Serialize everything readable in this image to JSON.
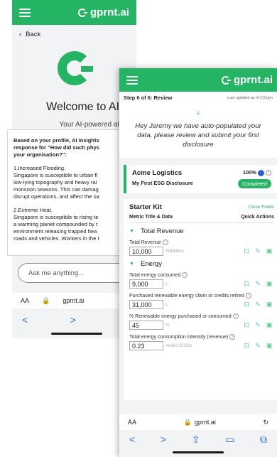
{
  "left": {
    "brand": "gprnt.ai",
    "back_label": "Back",
    "welcome_title": "Welcome to AI In",
    "tagline": "Your AI-powered ally f",
    "intro": [
      "Based on your profile, AI Insights",
      "response for \"How did such phys",
      "your organisation?\":"
    ],
    "sections": [
      {
        "title": "1.Increased Flooding.",
        "lines": [
          "Singapore is susceptible to urban fl",
          "low-lying topography and heavy rai",
          "monsoon seasons. This can damag",
          "disrupt operations, and affect the sa"
        ]
      },
      {
        "title": "2.Extreme Heat.",
        "lines": [
          "Singapore is susceptible to rising te",
          "a warming planet compounded by t",
          "environment releasing trapped hea",
          "roads and vehicles. Workers in the t"
        ]
      }
    ],
    "ask_placeholder": "Ask me anything...",
    "browser": {
      "text_size": "AA",
      "url": "gprnt.ai"
    },
    "nav": {
      "back": "<",
      "forward": ">",
      "share": "⇧"
    }
  },
  "right": {
    "brand": "gprnt.ai",
    "step": "Step 6 of 6: Review",
    "last_updated": "Last updated as of 2:01pm",
    "message": [
      "Hey Jeremy we have auto-populated your",
      "data, please review and submit your first",
      "disclosure"
    ],
    "company": {
      "name": "Acme Logistics",
      "subtitle": "My First ESG Disclosure",
      "percent": "100%",
      "status": "Completed"
    },
    "kit": {
      "title": "Starter Kit",
      "close_label": "Close Fields",
      "col_left": "Metric Title & Data",
      "col_right": "Quick Actions"
    },
    "groups": [
      {
        "name": "Total Revenue",
        "fields": [
          {
            "label": "Total Revenue",
            "value": "10,000",
            "unit": "S$Million"
          }
        ]
      },
      {
        "name": "Energy",
        "fields": [
          {
            "label": "Total energy consumed",
            "value": "9,000",
            "unit": "L"
          },
          {
            "label": "Purchased renewable energy claim or credits retired",
            "value": "31,000",
            "unit": "L"
          },
          {
            "label": "% Renewable energy purchased or consumed",
            "value": "45",
            "unit": "%"
          },
          {
            "label": "Total energy consumption intensity (revenue)",
            "value": "0.23",
            "unit": "metric tCO2e"
          }
        ]
      }
    ],
    "browser": {
      "text_size": "AA",
      "url": "gprnt.ai"
    },
    "nav": {
      "back": "<",
      "forward": ">",
      "share": "⇧",
      "bookmarks": "▭",
      "tabs": "⧉"
    }
  }
}
